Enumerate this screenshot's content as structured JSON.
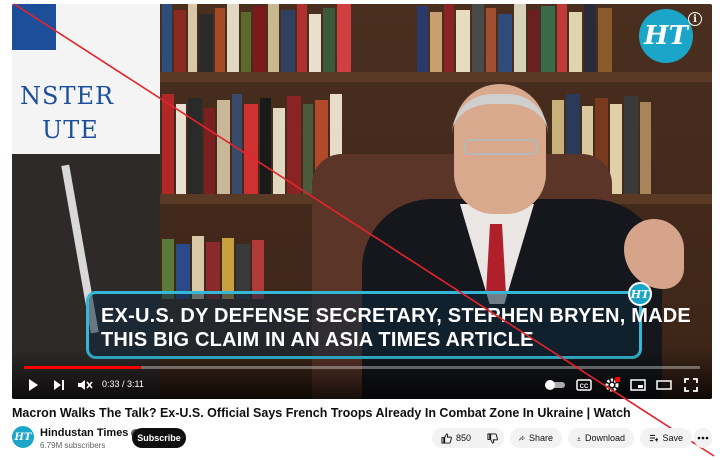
{
  "player": {
    "banner_lines": [
      "NSTER",
      "UTE"
    ],
    "logo_text": "HT",
    "caption_lines": [
      "EX-U.S. DY DEFENSE SECRETARY, STEPHEN BRYEN, MADE",
      "THIS BIG CLAIM IN AN ASIA TIMES ARTICLE"
    ],
    "caption_logo_text": "HT",
    "time_display": "0:33 / 3:11",
    "progress_fraction": 0.173,
    "progress_color": "#ff0000",
    "icons": [
      "play-icon",
      "next-icon",
      "mute-icon",
      "autoplay-toggle-icon",
      "captions-icon",
      "settings-icon",
      "miniplayer-icon",
      "theater-icon",
      "fullscreen-icon",
      "info-icon"
    ]
  },
  "video": {
    "title": "Macron Walks The Talk? Ex-U.S. Official Says French Troops Already In Combat Zone In Ukraine | Watch"
  },
  "channel": {
    "avatar_text": "HT",
    "name": "Hindustan Times",
    "subscribers": "6.79M subscribers",
    "subscribe_label": "Subscribe"
  },
  "actions": {
    "like_count": "850",
    "share_label": "Share",
    "download_label": "Download",
    "save_label": "Save"
  },
  "colors": {
    "brand": "#1ba6c9",
    "strike": "#e3242b"
  }
}
